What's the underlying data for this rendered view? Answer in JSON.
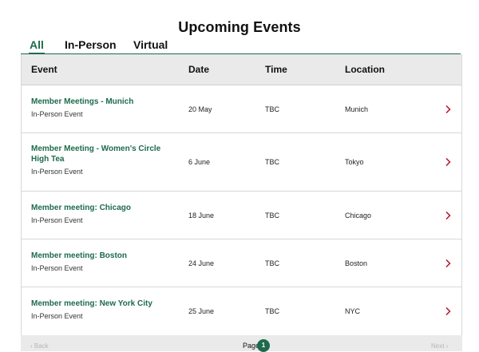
{
  "title": "Upcoming Events",
  "tabs": [
    {
      "label": "All",
      "active": true
    },
    {
      "label": "In-Person",
      "active": false
    },
    {
      "label": "Virtual",
      "active": false
    }
  ],
  "columns": [
    "Event",
    "Date",
    "Time",
    "Location"
  ],
  "rows": [
    {
      "title": "Member Meetings - Munich",
      "type": "In-Person Event",
      "date": "20 May",
      "time": "TBC",
      "location": "Munich"
    },
    {
      "title": "Member Meeting - Women's Circle High Tea",
      "type": "In-Person Event",
      "date": "6 June",
      "time": "TBC",
      "location": "Tokyo"
    },
    {
      "title": "Member meeting: Chicago",
      "type": "In-Person Event",
      "date": "18 June",
      "time": "TBC",
      "location": "Chicago"
    },
    {
      "title": "Member meeting: Boston",
      "type": "In-Person Event",
      "date": "24 June",
      "time": "TBC",
      "location": "Boston"
    },
    {
      "title": "Member meeting: New York City",
      "type": "In-Person Event",
      "date": "25 June",
      "time": "TBC",
      "location": "NYC"
    }
  ],
  "pagination": {
    "back_label": "‹ Back",
    "page_label": "Page",
    "current_page": "1",
    "next_label": "Next ›"
  },
  "colors": {
    "accent": "#1d6b4c",
    "chevron": "#b5132b",
    "header_bg": "#eaeaea"
  }
}
